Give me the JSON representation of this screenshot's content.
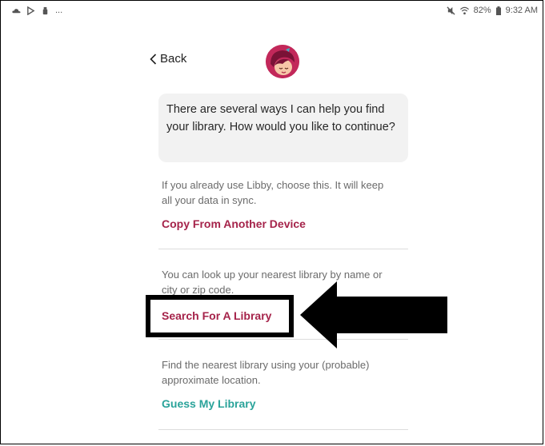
{
  "status_bar": {
    "left_icons": [
      "cloud-icon",
      "play-store-icon",
      "phone-cleaner-icon"
    ],
    "ellipsis": "...",
    "right_icons": [
      "mute-icon",
      "wifi-icon",
      "battery-icon"
    ],
    "battery": "82%",
    "time": "9:32 AM"
  },
  "header": {
    "back_label": "Back",
    "back_icon": "chevron-left-icon",
    "avatar_icon": "libby-mascot-icon"
  },
  "bubble": {
    "message": "There are several ways I can help you find your library. How would you like to continue?"
  },
  "options": [
    {
      "description": "If you already use Libby, choose this. It will keep all your data in sync.",
      "link": "Copy From Another Device",
      "color": "#a5234a"
    },
    {
      "description": "You can look up your nearest library by name or city or zip code.",
      "link": "Search For A Library",
      "color": "#a5234a"
    },
    {
      "description": "Find the nearest library using your (probable) approximate location.",
      "link": "Guess My Library",
      "color": "#2aa39a"
    }
  ],
  "annotation": {
    "highlight_color": "#000000",
    "arrow_icon": "left-arrow-icon"
  }
}
